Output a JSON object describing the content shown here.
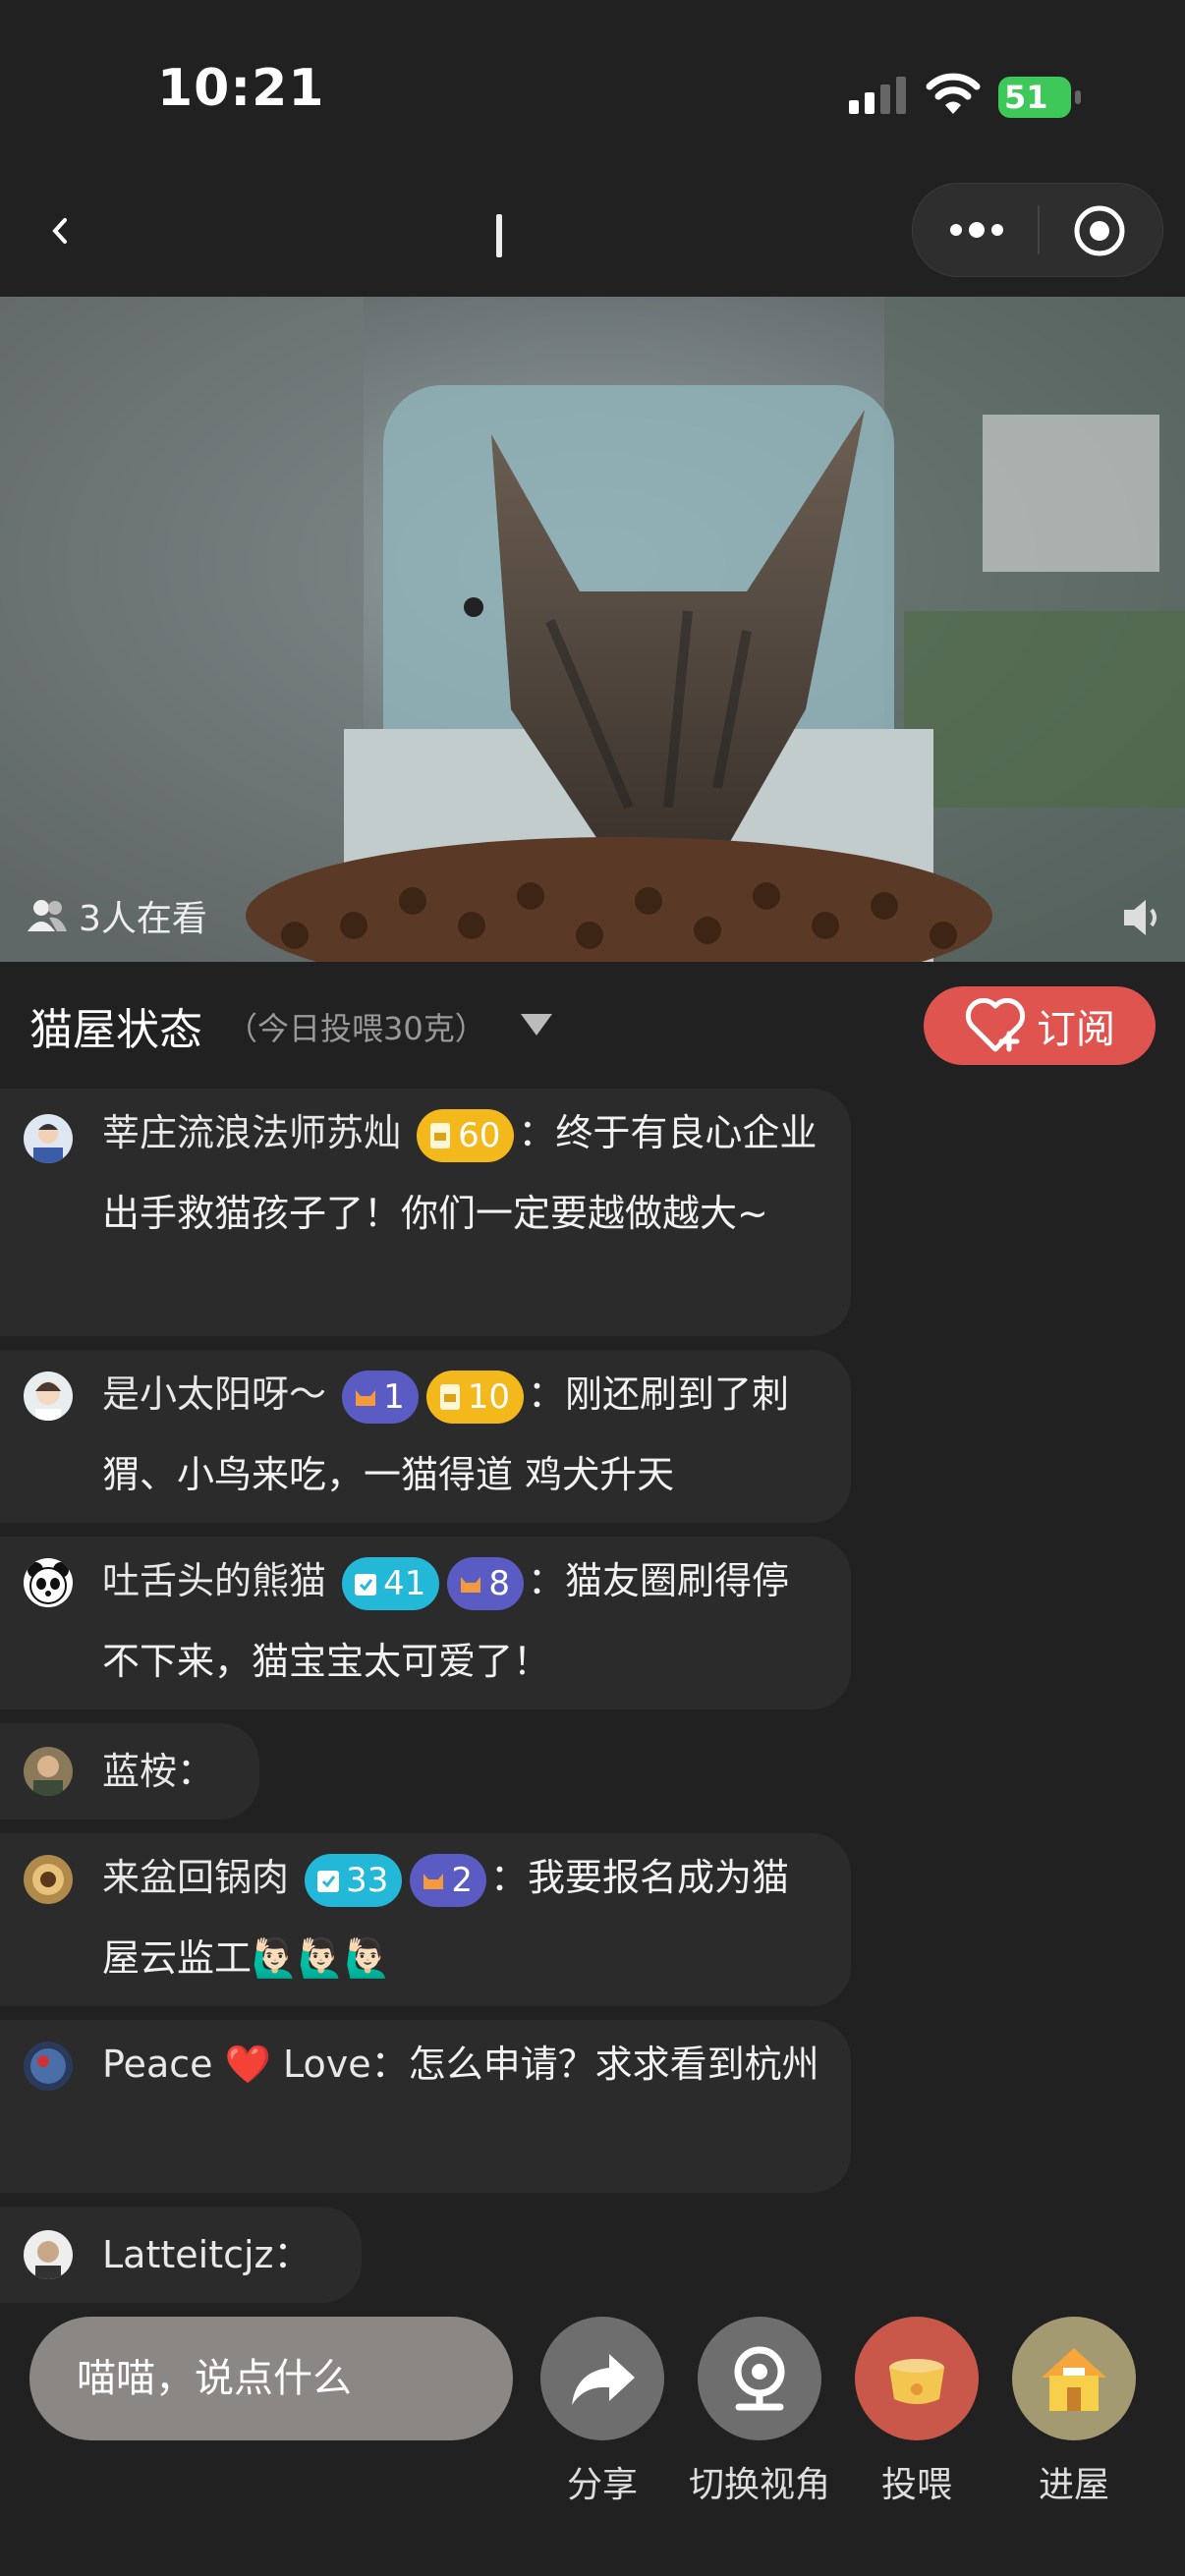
{
  "status_bar": {
    "time": "10:21",
    "battery": "51"
  },
  "video": {
    "viewer_count": "3人在看"
  },
  "cat_house": {
    "title": "猫屋状态",
    "subtitle": "（今日投喂30克）",
    "subscribe_label": "订阅"
  },
  "comments": [
    {
      "name": "莘庄流浪法师苏灿",
      "badges": [
        {
          "kind": "food",
          "value": "60"
        }
      ],
      "message": "：终于有良心企业出手救猫孩子了！你们一定要越做越大~"
    },
    {
      "name": "是小太阳呀～",
      "badges": [
        {
          "kind": "cat",
          "value": "1"
        },
        {
          "kind": "food",
          "value": "10"
        }
      ],
      "message": "：刚还刷到了刺猬、小鸟来吃，一猫得道 鸡犬升天"
    },
    {
      "name": "吐舌头的熊猫",
      "badges": [
        {
          "kind": "calendar",
          "value": "41"
        },
        {
          "kind": "cat",
          "value": "8"
        }
      ],
      "message": "：猫友圈刷得停不下来，猫宝宝太可爱了！"
    },
    {
      "name": "蓝桉",
      "message": "："
    },
    {
      "name": "来盆回锅肉",
      "badges": [
        {
          "kind": "calendar",
          "value": "33"
        },
        {
          "kind": "cat",
          "value": "2"
        }
      ],
      "message": "：我要报名成为猫屋云监工🙋🏻‍♂️🙋🏻‍♂️🙋🏻‍♂️"
    },
    {
      "name_part1": "Peace",
      "name_emoji": "❤️",
      "name_part2": "Love",
      "message": "：怎么申请？求求看到杭州"
    },
    {
      "name": "Latteitcjz",
      "message": "："
    }
  ],
  "chat": {
    "placeholder": "喵喵，说点什么"
  },
  "actions": [
    {
      "label": "分享",
      "icon": "share-icon",
      "color": "#6f6e6e"
    },
    {
      "label": "切换视角",
      "icon": "camera-icon",
      "color": "#6f6e6e"
    },
    {
      "label": "投喂",
      "icon": "food-bowl-icon",
      "color": "#c9574a"
    },
    {
      "label": "进屋",
      "icon": "house-icon",
      "color": "#a39a72"
    }
  ]
}
